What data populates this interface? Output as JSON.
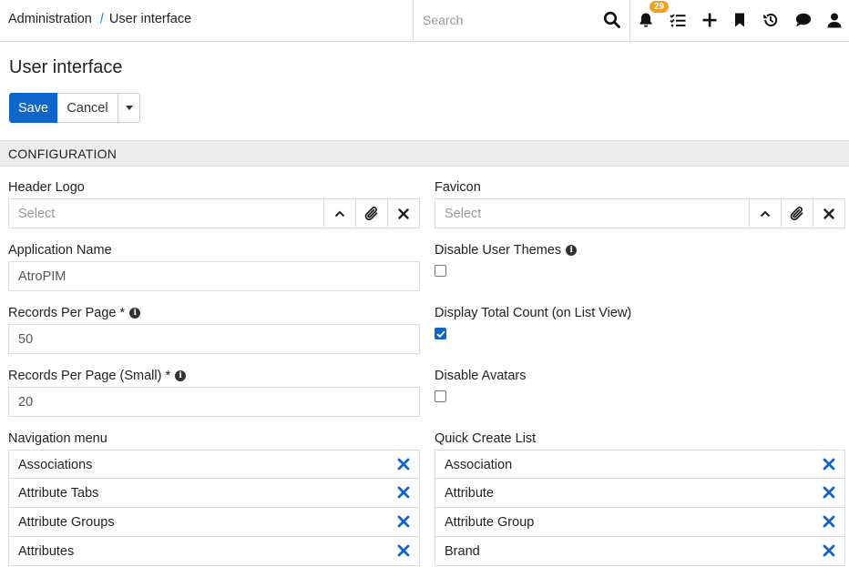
{
  "breadcrumb": {
    "parent": "Administration",
    "separator": "/",
    "current": "User interface"
  },
  "search": {
    "placeholder": "Search"
  },
  "notifications": {
    "count": "29"
  },
  "header": {
    "title": "User interface"
  },
  "actions": {
    "save": "Save",
    "cancel": "Cancel"
  },
  "panel": {
    "title": "CONFIGURATION"
  },
  "fields": {
    "header_logo": {
      "label": "Header Logo",
      "placeholder": "Select"
    },
    "favicon": {
      "label": "Favicon",
      "placeholder": "Select"
    },
    "application_name": {
      "label": "Application Name",
      "value": "AtroPIM"
    },
    "disable_user_themes": {
      "label": "Disable User Themes",
      "checked": false
    },
    "records_per_page": {
      "label": "Records Per Page *",
      "value": "50"
    },
    "display_total_count": {
      "label": "Display Total Count (on List View)",
      "checked": true
    },
    "records_per_page_small": {
      "label": "Records Per Page (Small) *",
      "value": "20"
    },
    "disable_avatars": {
      "label": "Disable Avatars",
      "checked": false
    },
    "navigation_menu": {
      "label": "Navigation menu",
      "items": [
        "Associations",
        "Attribute Tabs",
        "Attribute Groups",
        "Attributes"
      ]
    },
    "quick_create_list": {
      "label": "Quick Create List",
      "items": [
        "Association",
        "Attribute",
        "Attribute Group",
        "Brand"
      ]
    }
  },
  "colors": {
    "primary": "#0f66c8",
    "badge": "#f0a020",
    "panel_header": "#ececec",
    "remove_icon": "#0f66c8"
  }
}
